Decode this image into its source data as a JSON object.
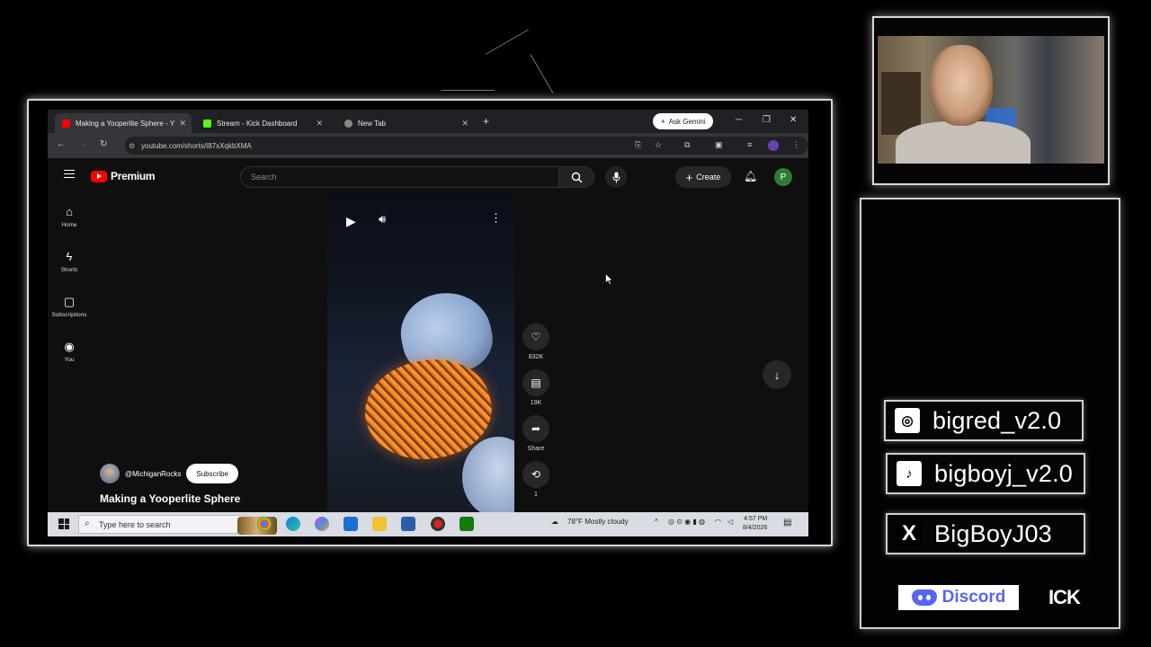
{
  "browser": {
    "tabs": [
      {
        "title": "Making a Yooperlite Sphere - Y",
        "active": true,
        "favicon_color": "#ff0000"
      },
      {
        "title": "Stream - Kick Dashboard",
        "active": false,
        "favicon_color": "#53fc18"
      },
      {
        "title": "New Tab",
        "active": false,
        "favicon_color": "#aaaaaa"
      }
    ],
    "new_tab_symbol": "+",
    "ask_gemini_label": "Ask Gemini",
    "url": "youtube.com/shorts/I87xXqkbXMA"
  },
  "youtube": {
    "logo_text": "Premium",
    "search_placeholder": "Search",
    "create_label": "Create",
    "avatar_letter": "P",
    "nav": [
      {
        "label": "Home",
        "icon": "home-icon"
      },
      {
        "label": "Shorts",
        "icon": "shorts-icon"
      },
      {
        "label": "Subscriptions",
        "icon": "subscriptions-icon"
      },
      {
        "label": "You",
        "icon": "you-icon"
      }
    ],
    "actions": [
      {
        "label": "832K",
        "icon": "like-icon"
      },
      {
        "label": "19K",
        "icon": "comment-icon"
      },
      {
        "label": "Share",
        "icon": "share-icon"
      },
      {
        "label": "1",
        "icon": "remix-icon"
      }
    ],
    "channel_handle": "@MichiganRocks",
    "subscribe_label": "Subscribe",
    "video_title": "Making a Yooperlite Sphere"
  },
  "taskbar": {
    "search_text": "Type here to search",
    "weather": "78°F  Mostly cloudy",
    "time": "4:57 PM",
    "date": "8/4/2026"
  },
  "socials": [
    {
      "platform": "instagram",
      "handle": "bigred_v2.0",
      "icon": "instagram-icon"
    },
    {
      "platform": "tiktok",
      "handle": "bigboyj_v2.0",
      "icon": "tiktok-icon"
    },
    {
      "platform": "x",
      "handle": "BigBoyJ03",
      "icon": "x-icon"
    }
  ],
  "discord_label": "Discord",
  "kick_label": "ICK",
  "colors": {
    "accent_red": "#ff0000",
    "subscribe_bg": "#ffffff",
    "discord": "#5865f2",
    "avatar_green": "#2e7d32"
  }
}
